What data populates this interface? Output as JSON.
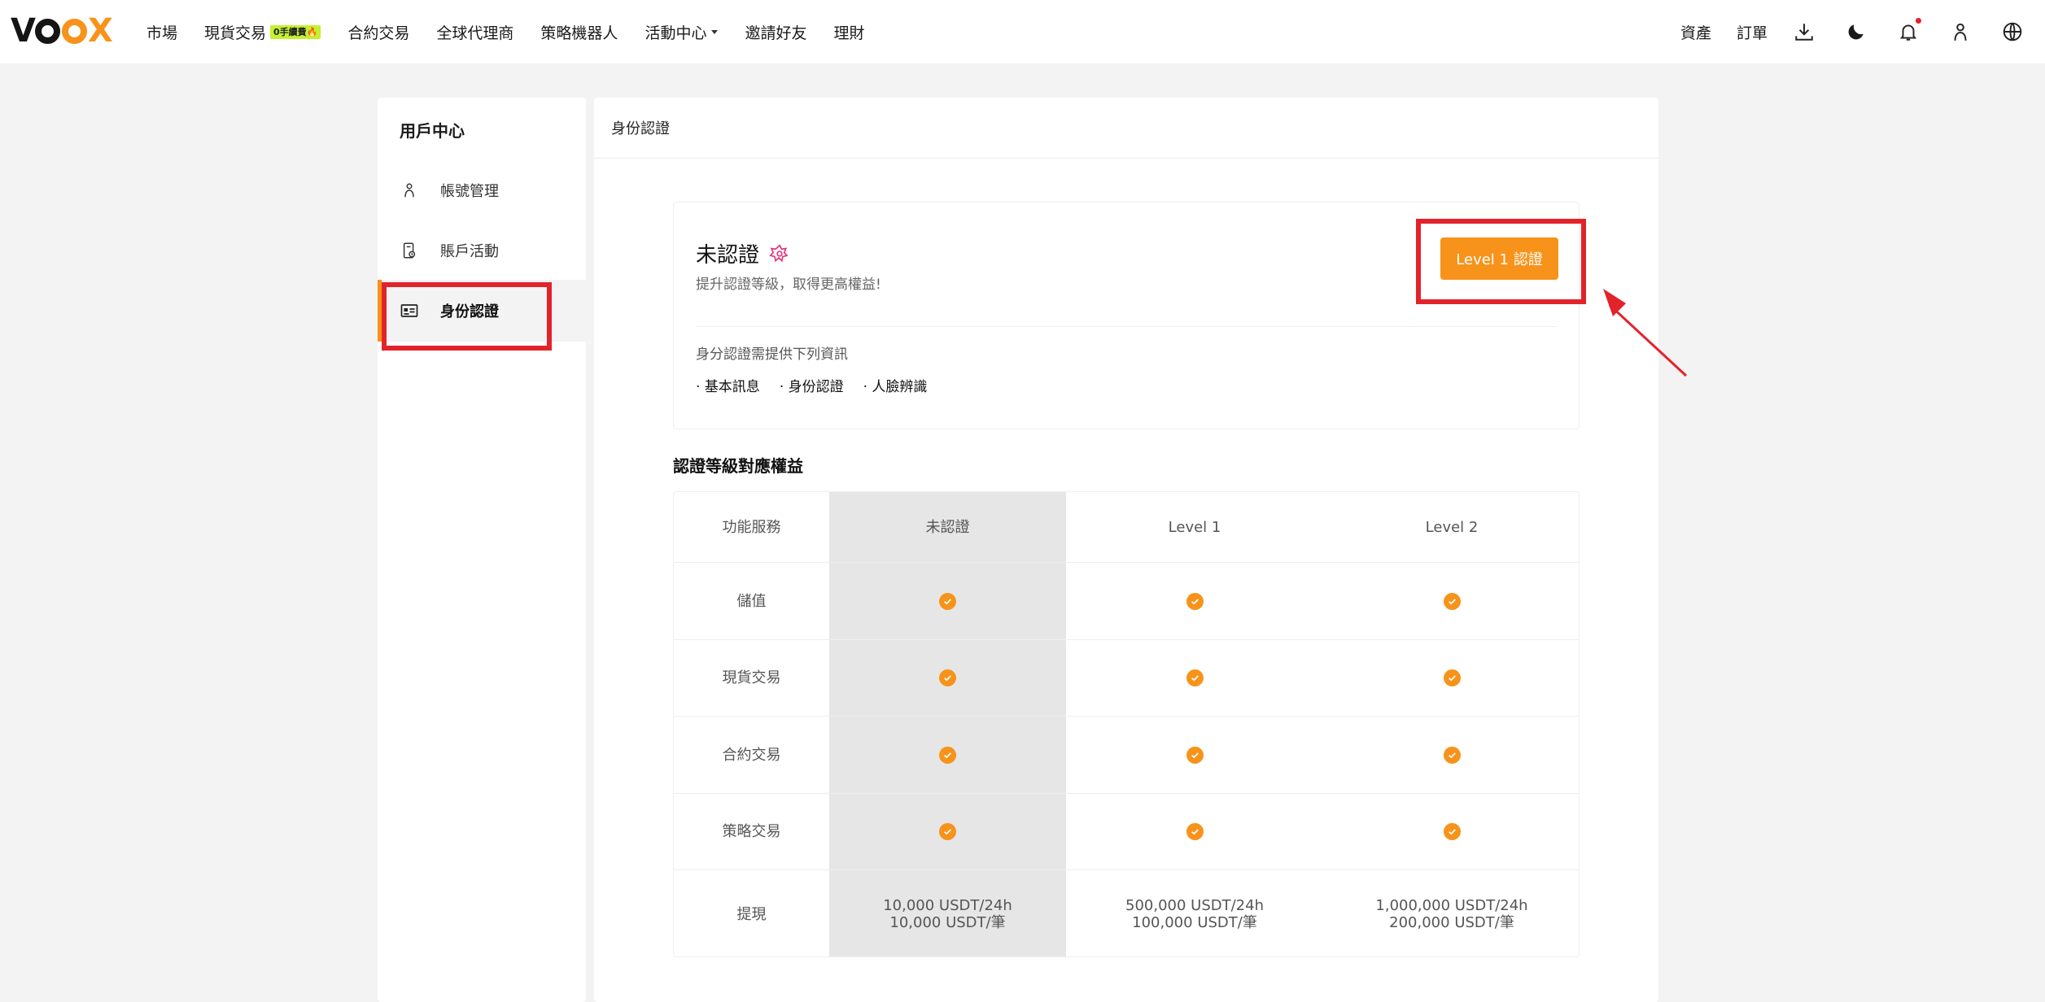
{
  "brand": {
    "logo_text": "VOOX",
    "accent": "#f7931a"
  },
  "nav": {
    "items": [
      {
        "label": "市場"
      },
      {
        "label": "現貨交易",
        "badge": "0手續費🔥"
      },
      {
        "label": "合約交易"
      },
      {
        "label": "全球代理商"
      },
      {
        "label": "策略機器人"
      },
      {
        "label": "活動中心",
        "dropdown": true
      },
      {
        "label": "邀請好友"
      },
      {
        "label": "理財"
      }
    ],
    "right": {
      "assets": "資產",
      "orders": "訂單"
    },
    "icons": [
      "download-icon",
      "moon-icon",
      "bell-icon",
      "user-icon",
      "globe-icon"
    ]
  },
  "sidebar": {
    "title": "用戶中心",
    "items": [
      {
        "label": "帳號管理",
        "icon": "user-icon"
      },
      {
        "label": "賬戶活動",
        "icon": "activity-icon"
      },
      {
        "label": "身份認證",
        "icon": "id-card-icon",
        "active": true
      }
    ]
  },
  "main": {
    "header": "身份認證",
    "status": {
      "title": "未認證",
      "subtitle": "提升認證等級，取得更高權益!",
      "button": "Level 1 認證",
      "req_title": "身分認證需提供下列資訊",
      "requirements": [
        "· 基本訊息",
        "· 身份認證",
        "· 人臉辨識"
      ]
    },
    "benefits": {
      "title": "認證等級對應權益",
      "headers": [
        "功能服務",
        "未認證",
        "Level 1",
        "Level 2"
      ],
      "rows": [
        {
          "label": "儲值",
          "values": [
            true,
            true,
            true
          ]
        },
        {
          "label": "現貨交易",
          "values": [
            true,
            true,
            true
          ]
        },
        {
          "label": "合約交易",
          "values": [
            true,
            true,
            true
          ]
        },
        {
          "label": "策略交易",
          "values": [
            true,
            true,
            true
          ]
        }
      ],
      "withdraw": {
        "label": "提現",
        "values": [
          [
            "10,000 USDT/24h",
            "10,000 USDT/筆"
          ],
          [
            "500,000 USDT/24h",
            "100,000 USDT/筆"
          ],
          [
            "1,000,000 USDT/24h",
            "200,000 USDT/筆"
          ]
        ]
      }
    }
  },
  "annotation_color": "#e3232c"
}
